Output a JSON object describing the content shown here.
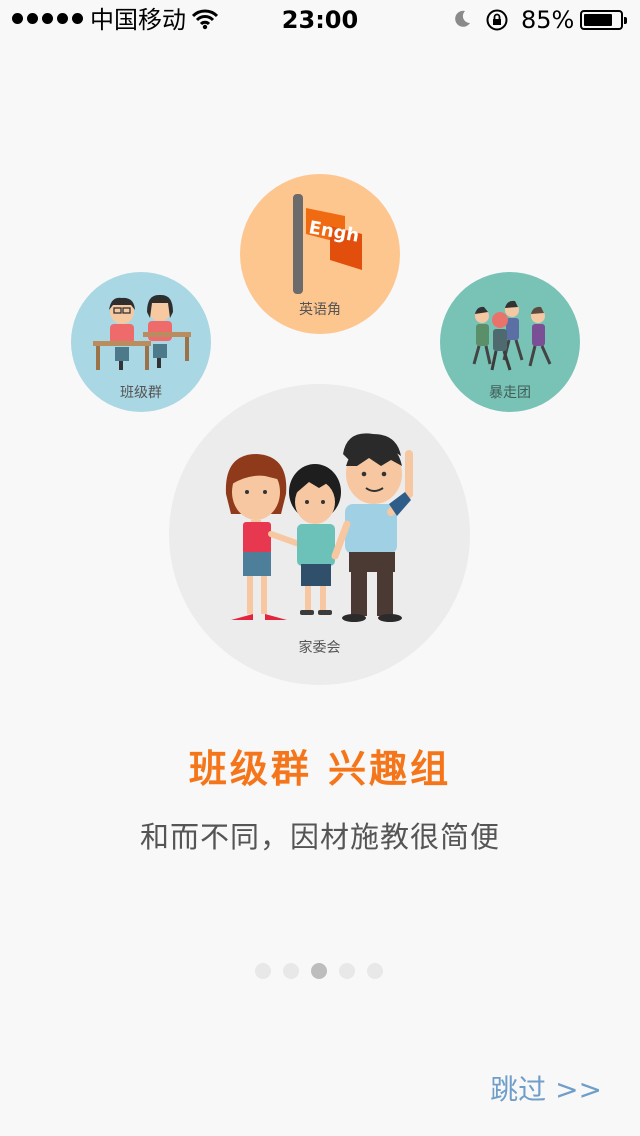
{
  "status_bar": {
    "carrier": "中国移动",
    "time": "23:00",
    "battery_percent": "85%",
    "battery_level": 0.85,
    "icons": [
      "signal-dots-icon",
      "wifi-icon",
      "moon-icon",
      "rotation-lock-icon",
      "battery-icon"
    ]
  },
  "groups": {
    "english": "英语角",
    "flag_text": "Engh",
    "class_group": "班级群",
    "walking": "暴走团",
    "family": "家委会"
  },
  "headline": "班级群 兴趣组",
  "subtitle": "和而不同，因材施教很简便",
  "pager": {
    "count": 5,
    "active_index": 2
  },
  "skip_label": "跳过 >>",
  "colors": {
    "accent": "#f5761a",
    "skip": "#6f9ec9",
    "english_circle": "#fdc68f",
    "class_circle": "#a9d7e4",
    "walk_circle": "#79c3b6",
    "family_circle": "#ececec"
  }
}
